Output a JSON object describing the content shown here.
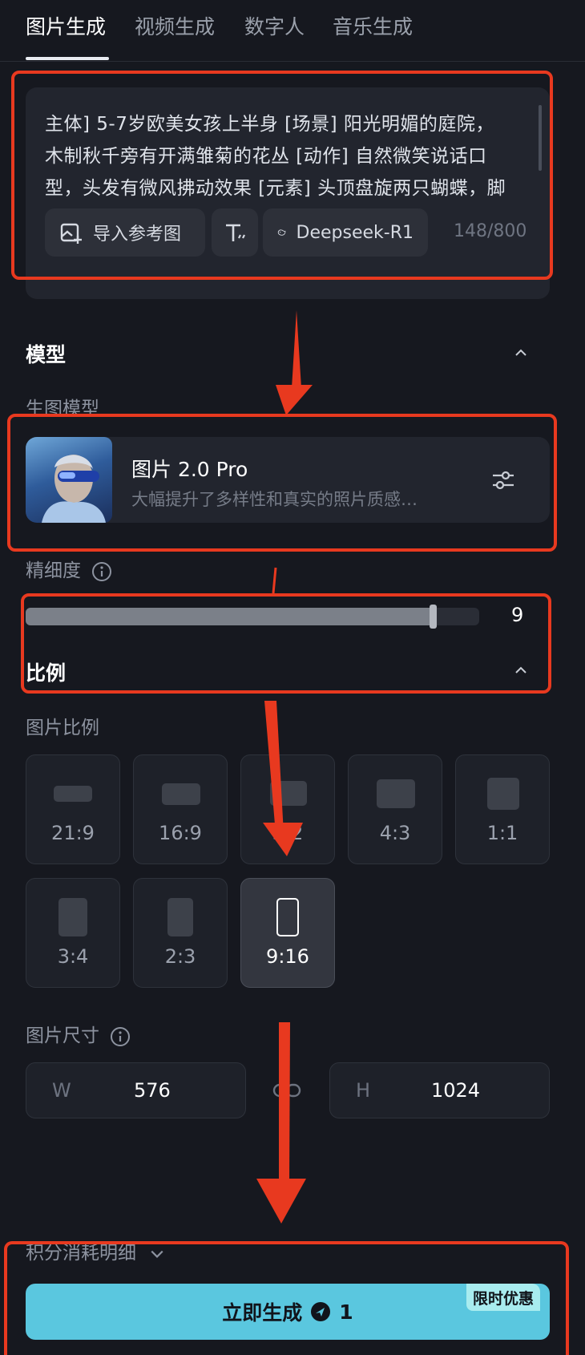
{
  "tabs": [
    {
      "label": "图片生成",
      "active": true
    },
    {
      "label": "视频生成",
      "active": false
    },
    {
      "label": "数字人",
      "active": false
    },
    {
      "label": "音乐生成",
      "active": false
    }
  ],
  "prompt": {
    "text": "主体] 5-7岁欧美女孩上半身 [场景] 阳光明媚的庭院，木制秋千旁有开满雏菊的花丛 [动作] 自然微笑说话口型，头发有微风拂动效果 [元素] 头顶盘旋两只蝴蝶，脚边有蒲公英被风吹散 [风格] 超真实真人",
    "import_ref_label": "导入参考图",
    "text_style_icon": "text-format-icon",
    "model_pill_label": "Deepseek-R1",
    "counter": "148/800"
  },
  "model_section": {
    "title": "模型",
    "sub_label": "生图模型",
    "model_name": "图片 2.0 Pro",
    "model_desc": "大幅提升了多样性和真实的照片质感…"
  },
  "detail": {
    "label": "精细度",
    "value": "9",
    "level_fraction": 0.9
  },
  "ratio_section": {
    "title": "比例",
    "sub_label": "图片比例",
    "options": [
      {
        "label": "21:9",
        "selected": false
      },
      {
        "label": "16:9",
        "selected": false
      },
      {
        "label": "3:2",
        "selected": false
      },
      {
        "label": "4:3",
        "selected": false
      },
      {
        "label": "1:1",
        "selected": false
      },
      {
        "label": "3:4",
        "selected": false
      },
      {
        "label": "2:3",
        "selected": false
      },
      {
        "label": "9:16",
        "selected": true
      }
    ]
  },
  "size": {
    "label": "图片尺寸",
    "w_prefix": "W",
    "w_value": "576",
    "h_prefix": "H",
    "h_value": "1024"
  },
  "footer": {
    "cost_label": "积分消耗明细",
    "generate_label": "立即生成",
    "generate_cost": "1",
    "promo_badge": "限时优惠"
  },
  "colors": {
    "accent": "#5ac7df",
    "annotation": "#e8391f",
    "background": "#16181f"
  }
}
